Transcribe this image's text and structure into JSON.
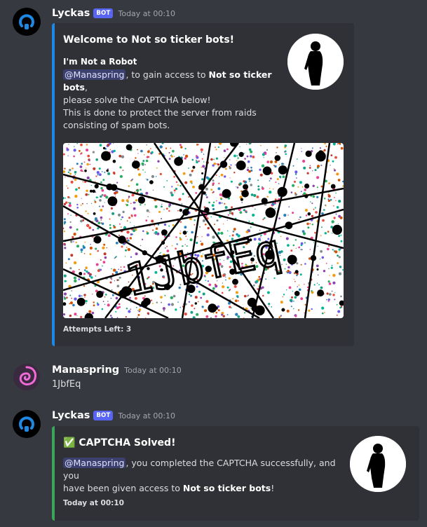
{
  "messages": [
    {
      "author": "Lyckas",
      "tag": "BOT",
      "timestamp": "Today at 00:10",
      "embed": {
        "title": "Welcome to Not so ticker bots!",
        "subtitle": "I'm Not a Robot",
        "mention": "@Manaspring",
        "line1_mid": ", to gain access to ",
        "server": "Not so ticker bots",
        "line1_end": ",",
        "line2": "please solve the CAPTCHA below!",
        "para2_line1": "This is done to protect the server from raids",
        "para2_line2": "consisting of spam bots.",
        "captcha_text": "1JbfEq",
        "footer": "Attempts Left: 3",
        "accent_color": "#1e88e5"
      }
    },
    {
      "author": "Manaspring",
      "timestamp": "Today at 00:10",
      "content": "1JbfEq"
    },
    {
      "author": "Lyckas",
      "tag": "BOT",
      "timestamp": "Today at 00:10",
      "embed": {
        "emoji": "✅",
        "title": "CAPTCHA Solved!",
        "mention": "@Manaspring",
        "line1_end": ", you completed the CAPTCHA successfully, and you",
        "line2_start": "have been given access to ",
        "server": "Not so ticker bots",
        "line2_end": "!",
        "footer": "Today at 00:10",
        "accent_color": "#3ba55c"
      }
    }
  ]
}
